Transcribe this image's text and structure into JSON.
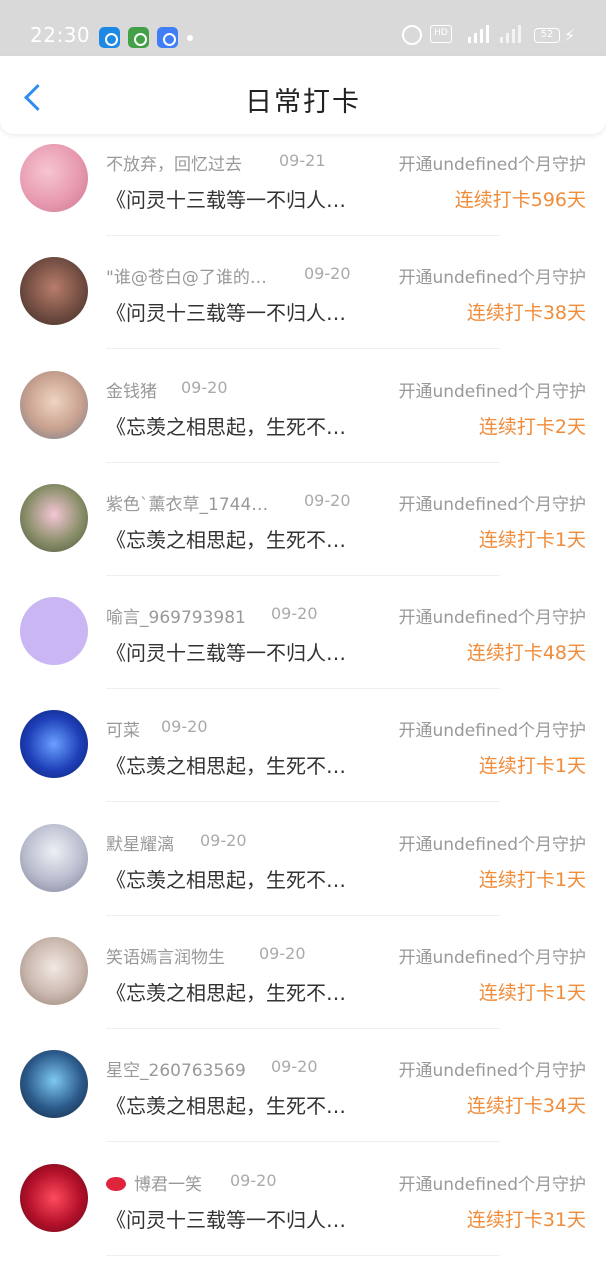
{
  "status_bar": {
    "time": "22:30",
    "hd_label": "HD",
    "battery": "52"
  },
  "header": {
    "title": "日常打卡",
    "back_icon": "chevron-left-icon"
  },
  "colors": {
    "accent_blue": "#2d8cf0",
    "streak_orange": "#f08c3a",
    "status_bar_bg": "#d9d9d9"
  },
  "items": [
    {
      "name": "不放弃，回忆过去",
      "date": "09-21",
      "guard": "开通undefined个月守护",
      "title": "《问灵十三载等一不归人…",
      "streak": "连续打卡596天",
      "avatar_icon": "pink-blossom-avatar"
    },
    {
      "name": "\"谁@苍白@了谁的…",
      "date": "09-20",
      "guard": "开通undefined个月守护",
      "title": "《问灵十三载等一不归人…",
      "streak": "连续打卡38天",
      "avatar_icon": "people-photo-avatar"
    },
    {
      "name": "金钱猪",
      "date": "09-20",
      "guard": "开通undefined个月守护",
      "title": "《忘羡之相思起，生死不…",
      "streak": "连续打卡2天",
      "avatar_icon": "selfie-avatar"
    },
    {
      "name": "紫色`薰衣草_1744…",
      "date": "09-20",
      "guard": "开通undefined个月守护",
      "title": "《忘羡之相思起，生死不…",
      "streak": "连续打卡1天",
      "avatar_icon": "child-photo-avatar"
    },
    {
      "name": "喻言_969793981",
      "date": "09-20",
      "guard": "开通undefined个月守护",
      "title": "《问灵十三载等一不归人…",
      "streak": "连续打卡48天",
      "avatar_icon": "default-chat-avatar"
    },
    {
      "name": "可菜",
      "date": "09-20",
      "guard": "开通undefined个月守护",
      "title": "《忘羡之相思起，生死不…",
      "streak": "连续打卡1天",
      "avatar_icon": "blue-butterfly-avatar"
    },
    {
      "name": "默星耀漓",
      "date": "09-20",
      "guard": "开通undefined个月守护",
      "title": "《忘羡之相思起，生死不…",
      "streak": "连续打卡1天",
      "avatar_icon": "anime-character-avatar"
    },
    {
      "name": "笑语嫣言润物生",
      "date": "09-20",
      "guard": "开通undefined个月守护",
      "title": "《忘羡之相思起，生死不…",
      "streak": "连续打卡1天",
      "avatar_icon": "boy-portrait-avatar"
    },
    {
      "name": "星空_260763569",
      "date": "09-20",
      "guard": "开通undefined个月守护",
      "title": "《忘羡之相思起，生死不…",
      "streak": "连续打卡34天",
      "avatar_icon": "fantasy-art-avatar"
    },
    {
      "name": "博君一笑",
      "date": "09-20",
      "guard": "开通undefined个月守护",
      "title": "《问灵十三载等一不归人…",
      "streak": "连续打卡31天",
      "avatar_icon": "red-lips-avatar",
      "name_prefix_icon": "lips-icon"
    }
  ]
}
